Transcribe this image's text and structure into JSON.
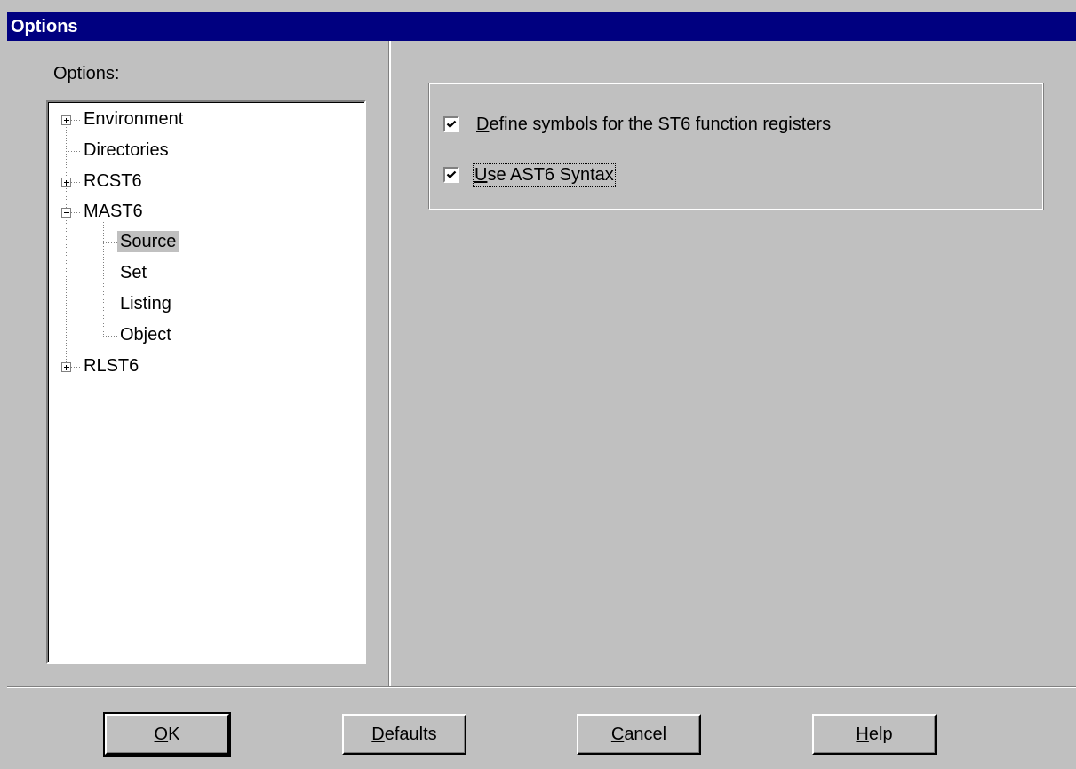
{
  "window": {
    "title": "Options"
  },
  "left": {
    "label": "Options:",
    "tree": [
      {
        "label": "Environment",
        "expander": "plus"
      },
      {
        "label": "Directories",
        "expander": "none"
      },
      {
        "label": "RCST6",
        "expander": "plus"
      },
      {
        "label": "MAST6",
        "expander": "minus"
      },
      {
        "label": "Source",
        "selected": true
      },
      {
        "label": "Set"
      },
      {
        "label": "Listing"
      },
      {
        "label": "Object"
      },
      {
        "label": "RLST6",
        "expander": "plus"
      }
    ]
  },
  "settings": {
    "define_symbols": {
      "accel": "D",
      "rest": "efine symbols for the ST6 function registers",
      "checked": true
    },
    "use_ast6": {
      "accel": "U",
      "rest": "se AST6 Syntax",
      "checked": true
    }
  },
  "buttons": {
    "ok": {
      "accel": "O",
      "rest": "K"
    },
    "defaults": {
      "accel": "D",
      "rest": "efaults"
    },
    "cancel": {
      "accel": "C",
      "rest": "ancel"
    },
    "help": {
      "accel": "H",
      "rest": "elp"
    }
  }
}
